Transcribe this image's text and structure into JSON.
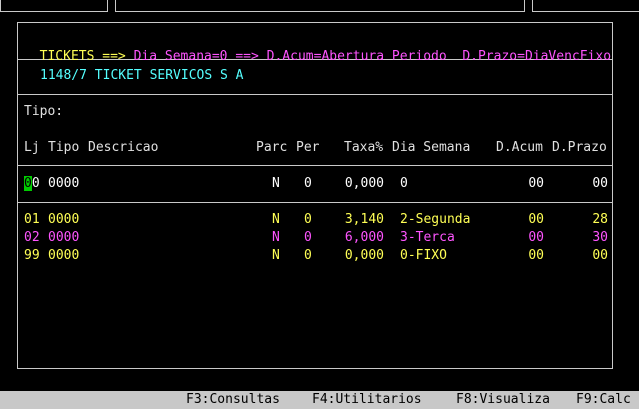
{
  "header": {
    "label_tickets": "TICKETS",
    "arrow1": "==>",
    "dia_semana": "Dia Semana=0",
    "arrow2": "==>",
    "d_acum": "D.Acum=Abertura Periodo",
    "d_prazo": "D.Prazo=DiaVencFixo"
  },
  "company": "1148/7 TICKET SERVICOS S A",
  "tipo_label": "Tipo:",
  "columns": {
    "lj": "Lj",
    "tipo": "Tipo",
    "descricao": "Descricao",
    "parc": "Parc",
    "per": "Per",
    "taxa": "Taxa%",
    "dia_semana": "Dia Semana",
    "d_acum": "D.Acum",
    "d_prazo": "D.Prazo"
  },
  "edit_row": {
    "lj_cursor": "0",
    "lj_rest": "0",
    "tipo": "0000",
    "parc": "N",
    "per": "0",
    "taxa": "0,000",
    "dia_semana": "0",
    "d_acum": "00",
    "d_prazo": "00"
  },
  "rows": [
    {
      "lj": "01",
      "tipo": "0000",
      "parc": "N",
      "per": "0",
      "taxa": "3,140",
      "dia_semana": "2-Segunda",
      "d_acum": "00",
      "d_prazo": "28",
      "color": "#ffff55"
    },
    {
      "lj": "02",
      "tipo": "0000",
      "parc": "N",
      "per": "0",
      "taxa": "6,000",
      "dia_semana": "3-Terca",
      "d_acum": "00",
      "d_prazo": "30",
      "color": "#ff55ff"
    },
    {
      "lj": "99",
      "tipo": "0000",
      "parc": "N",
      "per": "0",
      "taxa": "0,000",
      "dia_semana": "0-FIXO",
      "d_acum": "00",
      "d_prazo": "00",
      "color": "#ffff55"
    }
  ],
  "footer": {
    "f3": "F3:Consultas",
    "f4": "F4:Utilitarios",
    "f8": "F8:Visualiza",
    "f9": "F9:Calc"
  },
  "colors": {
    "yellow": "#ffff55",
    "magenta": "#ff55ff",
    "cyan": "#55ffff",
    "cursor_green": "#00cc00",
    "footer_bg": "#c8c8c8"
  }
}
